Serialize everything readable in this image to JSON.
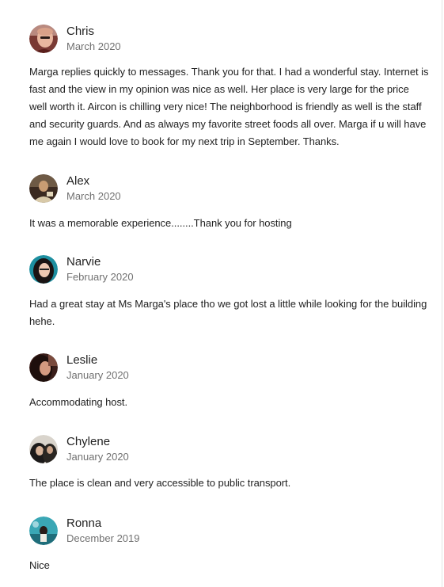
{
  "reviews": [
    {
      "name": "Chris",
      "date": "March 2020",
      "avatar_icon": "user-photo-icon",
      "comment": "Marga replies quickly to messages. Thank you for that. I had a wonderful stay. Internet is fast and the view in my opinion was nice as well. Her place is very large for the price well worth it. Aircon is chilling very nice! The neighborhood is friendly as well is the staff and security guards. And as always my favorite street foods all over. Marga if u will have me again I would love to book for my next trip in September. Thanks."
    },
    {
      "name": "Alex",
      "date": "March 2020",
      "avatar_icon": "user-photo-icon",
      "comment": "It was a memorable experience........Thank you for hosting"
    },
    {
      "name": "Narvie",
      "date": "February 2020",
      "avatar_icon": "user-photo-icon",
      "comment": "Had a great stay at Ms Marga's place tho we got lost a little while looking for the building hehe."
    },
    {
      "name": "Leslie",
      "date": "January 2020",
      "avatar_icon": "user-photo-icon",
      "comment": "Accommodating host."
    },
    {
      "name": "Chylene",
      "date": "January 2020",
      "avatar_icon": "user-photo-icon",
      "comment": "The place is clean and very accessible to public transport."
    },
    {
      "name": "Ronna",
      "date": "December 2019",
      "avatar_icon": "user-photo-icon",
      "comment": "Nice"
    }
  ]
}
